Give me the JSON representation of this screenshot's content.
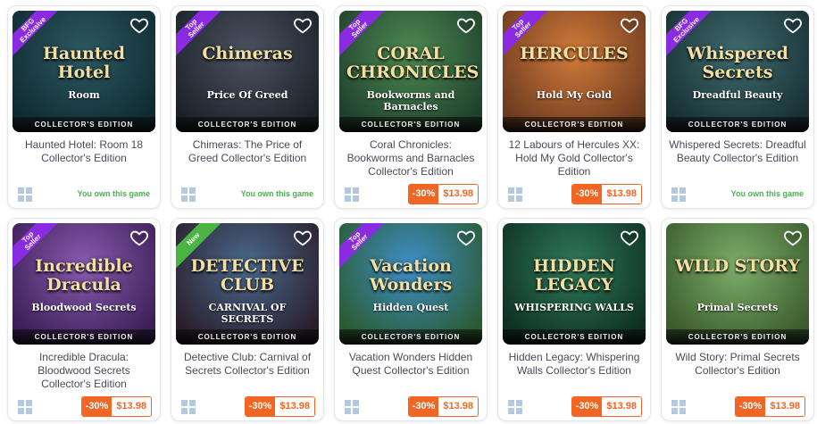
{
  "colors": {
    "ribbon_purple": "#8a2be2",
    "ribbon_new": "#4bb543",
    "price": "#f26522",
    "owned": "#4caf50",
    "windows": "#b4c8de"
  },
  "games": [
    {
      "title": "Haunted Hotel: Room 18 Collector's Edition",
      "badge": "BFG Exclusive",
      "art_title": "Haunted Hotel",
      "art_subtitle": "Room",
      "edition": "COLLECTOR'S EDITION",
      "owned_text": "You own this game",
      "favorite": false,
      "platform_icon": "windows-icon",
      "art_colors": [
        "#2d5963",
        "#0f2a31"
      ]
    },
    {
      "title": "Chimeras: The Price of Greed Collector's Edition",
      "badge": "Top Seller",
      "art_title": "Chimeras",
      "art_subtitle": "Price Of Greed",
      "edition": "COLLECTOR'S EDITION",
      "owned_text": "You own this game",
      "favorite": false,
      "platform_icon": "windows-icon",
      "art_colors": [
        "#4b5361",
        "#1c2129"
      ]
    },
    {
      "title": "Coral Chronicles: Bookworms and Barnacles Collector's Edition",
      "badge": "Top Seller",
      "art_title": "CORAL CHRONICLES",
      "art_subtitle": "Bookworms and Barnacles",
      "edition": "COLLECTOR'S EDITION",
      "discount": "-30%",
      "price": "$13.98",
      "favorite": false,
      "platform_icon": "windows-icon",
      "art_colors": [
        "#4e8a52",
        "#1e3f2c"
      ]
    },
    {
      "title": "12 Labours of Hercules XX: Hold My Gold Collector's Edition",
      "badge": "Top Seller",
      "art_title": "HERCULES",
      "art_subtitle": "Hold My Gold",
      "edition": "COLLECTOR'S EDITION",
      "discount": "-30%",
      "price": "$13.98",
      "favorite": false,
      "platform_icon": "windows-icon",
      "art_colors": [
        "#d17a3a",
        "#6b3a1f"
      ]
    },
    {
      "title": "Whispered Secrets: Dreadful Beauty Collector's Edition",
      "badge": "BFG Exclusive",
      "art_title": "Whispered Secrets",
      "art_subtitle": "Dreadful Beauty",
      "edition": "COLLECTOR'S EDITION",
      "owned_text": "You own this game",
      "favorite": false,
      "platform_icon": "windows-icon",
      "art_colors": [
        "#3f6b6e",
        "#172f33"
      ]
    },
    {
      "title": "Incredible Dracula: Bloodwood Secrets Collector's Edition",
      "badge": "Top Seller",
      "art_title": "Incredible Dracula",
      "art_subtitle": "Bloodwood Secrets",
      "edition": "COLLECTOR'S EDITION",
      "discount": "-30%",
      "price": "$13.98",
      "favorite": false,
      "platform_icon": "windows-icon",
      "art_colors": [
        "#8a5bb0",
        "#3a1e55"
      ]
    },
    {
      "title": "Detective Club: Carnival of Secrets Collector's Edition",
      "badge": "New",
      "art_title": "DETECTIVE CLUB",
      "art_subtitle": "CARNIVAL OF SECRETS",
      "edition": "COLLECTOR'S EDITION",
      "discount": "-30%",
      "price": "$13.98",
      "favorite": false,
      "platform_icon": "windows-icon",
      "art_colors": [
        "#4a6a8e",
        "#2a1d2a"
      ]
    },
    {
      "title": "Vacation Wonders Hidden Quest Collector's Edition",
      "badge": "Top Seller",
      "art_title": "Vacation Wonders",
      "art_subtitle": "Hidden Quest",
      "edition": "COLLECTOR'S EDITION",
      "discount": "-30%",
      "price": "$13.98",
      "favorite": false,
      "platform_icon": "windows-icon",
      "art_colors": [
        "#3e8fc9",
        "#2a5a2e"
      ]
    },
    {
      "title": "Hidden Legacy: Whispering Walls Collector's Edition",
      "badge": "",
      "art_title": "HIDDEN LEGACY",
      "art_subtitle": "WHISPERING WALLS",
      "edition": "COLLECTOR'S EDITION",
      "discount": "-30%",
      "price": "$13.98",
      "favorite": false,
      "platform_icon": "windows-icon",
      "art_colors": [
        "#2f7a5a",
        "#0e2f22"
      ]
    },
    {
      "title": "Wild Story: Primal Secrets Collector's Edition",
      "badge": "",
      "art_title": "WILD STORY",
      "art_subtitle": "Primal Secrets",
      "edition": "COLLECTOR'S EDITION",
      "discount": "-30%",
      "price": "$13.98",
      "favorite": false,
      "platform_icon": "windows-icon",
      "art_colors": [
        "#7cae6a",
        "#3a5a2c"
      ]
    }
  ]
}
